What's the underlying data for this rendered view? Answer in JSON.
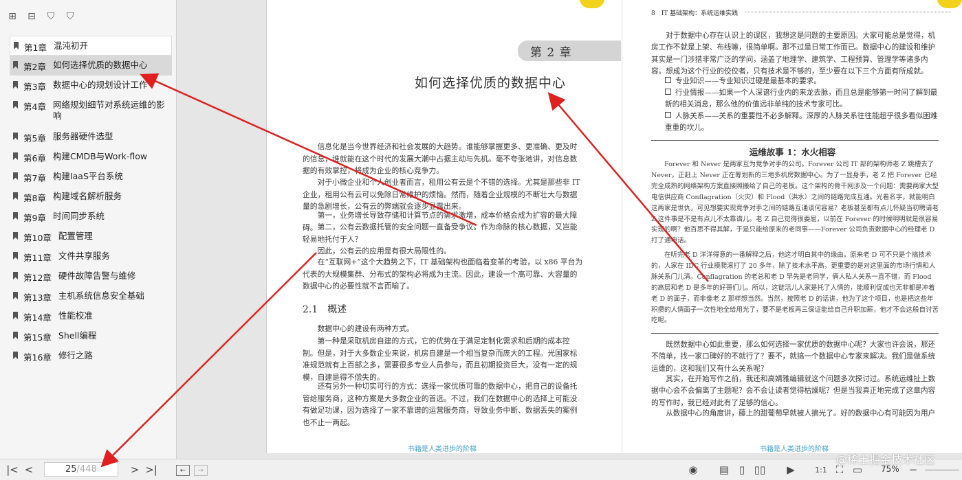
{
  "sidebar": {
    "tools": [
      "expand-all-icon",
      "collapse-all-icon",
      "bookmark-add-icon",
      "bookmark-icon"
    ],
    "items": [
      {
        "num": "第1章",
        "title": "混沌初开"
      },
      {
        "num": "第2章",
        "title": "如何选择优质的数据中心"
      },
      {
        "num": "第3章",
        "title": "数据中心的规划设计工作"
      },
      {
        "num": "第4章",
        "title": "网络规划细节对系统运维的影响"
      },
      {
        "num": "第5章",
        "title": "服务器硬件选型"
      },
      {
        "num": "第6章",
        "title": "构建CMDB与Work-flow"
      },
      {
        "num": "第7章",
        "title": "构建IaaS平台系统"
      },
      {
        "num": "第8章",
        "title": "构建域名解析服务"
      },
      {
        "num": "第9章",
        "title": "时间同步系统"
      },
      {
        "num": "第10章",
        "title": "配置管理"
      },
      {
        "num": "第11章",
        "title": "文件共享服务"
      },
      {
        "num": "第12章",
        "title": "硬件故障告警与维修"
      },
      {
        "num": "第13章",
        "title": "主机系统信息安全基础"
      },
      {
        "num": "第14章",
        "title": "性能校准"
      },
      {
        "num": "第15章",
        "title": "Shell编程"
      },
      {
        "num": "第16章",
        "title": "修行之路"
      }
    ]
  },
  "left_page": {
    "chapter_tag": "第 2 章",
    "chapter_title": "如何选择优质的数据中心",
    "paragraphs": [
      "信息化是当今世界经济和社会发展的大趋势。谁能够掌握更多、更准确、更及时的信息，谁就能在这个时代的发展大潮中占据主动与先机。毫不夸张地讲，对信息数据的有效掌控，将成为企业的核心竞争力。",
      "对于小微企业和个人创业者而言，租用公有云是个不错的选择。尤其是那些非 IT 企业，租用公有云可以免除日常维护的烦恼。然而，随着企业规模的不断壮大与数据量的急剧增长，公有云的弊端就会逐步显露出来。",
      "第一，业务增长导致存储和计算节点的需求激增，成本价格会成为扩容的最大障碍。",
      "第二，公有云数据托管的安全问题一直备受争议。作为命脉的核心数据，又岂能轻易地托付于人？",
      "因此，公有云的应用是有很大局限性的。",
      "在“互联网+”这个大趋势之下，IT 基础架构也面临着变革的考验，以 x86 平台为代表的大规模集群、分布式的架构必将成为主流。因此，建设一个高可靠、大容量的数据中心的必要性就不言而喻了。"
    ],
    "section": "2.1　概述",
    "section_paragraphs": [
      "数据中心的建设有两种方式。",
      "第一种是采取机房自建的方式，它的优势在于满足定制化需求和后期的成本控制。但是，对于大多数企业来说，机房自建是一个相当复杂而庞大的工程。光国家标准规范就有上百部之多，需要很多专业人员参与，而且初期投资巨大，没有一定的规模，自建是得不偿失的。",
      "还有另外一种切实可行的方式：选择一家优质可靠的数据中心，把自己的设备托管给服务商，这种方案是大多数企业的首选。不过，我们在数据中心的选择上可能没有做足功课，因为选择了一家不靠谱的运营服务商，导致业务中断、数据丢失的案例也不止一两起。"
    ],
    "footer": "书籍是人类进步的阶梯"
  },
  "right_page": {
    "header": "8　IT 基础架构：系统运维实践",
    "intro": "对于数据中心存在认识上的误区，我想这是问题的主要原因。大家可能总是觉得，机房工作不就是上架、布线嘛，很简单啊。那不过是日常工作而已。数据中心的建设和维护其实是一门涉猎非常广泛的学问，涵盖了地理学、建筑学、工程预算、管理学等诸多内容。想成为这个行业的佼佼者，只有技术是不够的，至少要在以下三个方面有所成就。",
    "bullets": [
      "专业知识——专业知识过硬是最基本的要求。",
      "行业情报——如果一个人深谙行业内的来龙去脉，而且总是能够第一时间了解到最新的相关消息，那么他的价值远非单纯的技术专家可比。",
      "人脉关系——关系的重要性不必多解释。深厚的人脉关系往往能超乎很多看似困难重重的坎儿。"
    ],
    "story_title": "运维故事 1：水火相容",
    "story": [
      "Forever 和 Never 是两家互为竞争对手的公司。Forever 公司 IT 部的架构师老 Z 跳槽去了 Never，正赶上 Never 正在筹划新的三地多机房数据中心。为了一显身手，老 Z 把 Forever 已经完全成熟的网络架构方案直接照搬给了自己的老板。这个架构的骨干网涉及一个问题：需要两家大型电信供应商 Conflagration（火灾）和 Flood（洪水）之间的链路完成互通。光看名字，就能明白这两家是世仇，可见想要实现竞争对手之间的链路互通谈何容易？老板甚至都有点儿怀疑当初聘请老 Z 这件事是不是有点儿不太靠谱儿。老 Z 自己觉得很委屈，以前在 Forever 的时候明明就是很容易实现的啊？他百思不得其解，于是只能给原来的老同事——Forever 公司负责数据中心的经理老 D 打了通电话。",
      "在听完老 D 洋洋得意的一番解释之后，他这才明白其中的缘由。原来老 D 可不只是个搞技术的，人家在 IDC 行业摸爬滚打了 20 多年，除了技术水平高，更重要的是对这里面的市场行情和人脉关系门儿清。Conflagration 的老总和老 D 早先是老同学，俩人私人关系一直不错，而 Flood 的高层和老 D 是多年的好哥们儿。所以，这链活儿人家是托了人情的，能顺利促成也无非都是冲着老 D 的面子，而非像老 Z 那样想当然。当然，按照老 D 的话讲，他为了这个项目，也是把这些年积攒的人情面子一次性地全给用光了，要不是老板再三保证能给自己升职加薪，他才不会这般自讨苦吃呢。"
    ],
    "after": [
      "既然数据中心如此重要，那么如何选择一家优质的数据中心呢？大家也许会说，那还不简单，找一家口碑好的不就行了？要不，就搞一个数据中心专家来解决。我们是做系统运维的，这和我们又有什么关系呢？",
      "其实，在开始写作之前，我还和高婧雅编辑就这个问题多次探讨过。系统运维扯上数据中心会不会偏离了主题呢？会不会让读者觉得枯燥呢？但是当我真正地完成了这章内容的写作时，我已经对此有了足够的信心。",
      "从数据中心的角度讲，藤上的甜葡萄早就被人摘光了。好的数据中心有可能因为用户"
    ],
    "footer": "书籍是人类进步的阶梯"
  },
  "toolbar": {
    "current_page": "25",
    "total_pages": "/448",
    "zoom": "75%"
  },
  "watermark": "@稀土掘金技术社区",
  "colors": {
    "arrow": "#e02020",
    "footer": "#4aa3c9",
    "active_item": "#d9d9d9"
  }
}
